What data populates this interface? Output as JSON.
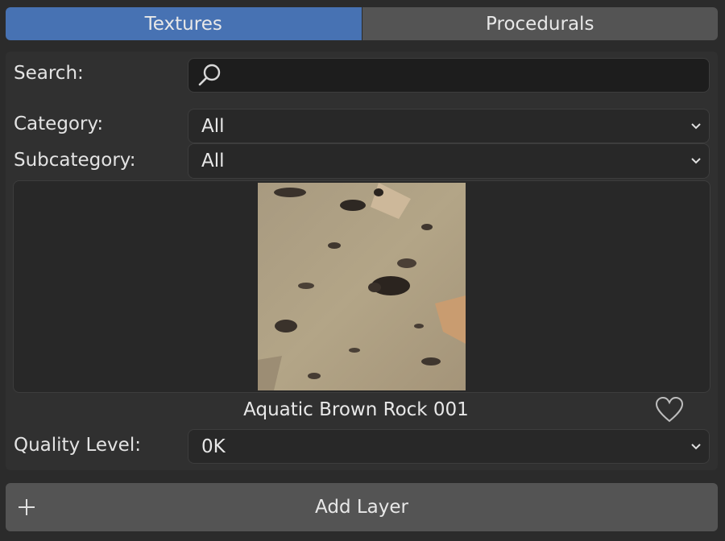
{
  "tabs": [
    {
      "label": "Textures",
      "active": true
    },
    {
      "label": "Procedurals",
      "active": false
    }
  ],
  "search": {
    "label": "Search:",
    "value": "",
    "icon": "search-icon"
  },
  "category": {
    "label": "Category:",
    "value": "All"
  },
  "subcategory": {
    "label": "Subcategory:",
    "value": "All"
  },
  "asset": {
    "name": "Aquatic Brown Rock 001",
    "favorite_icon": "heart-icon"
  },
  "quality": {
    "label": "Quality Level:",
    "value": "0K"
  },
  "add_layer": {
    "label": "Add Layer",
    "icon": "plus-icon"
  },
  "colors": {
    "accent": "#4772b3",
    "panel": "#303030",
    "background": "#2b2b2b"
  }
}
